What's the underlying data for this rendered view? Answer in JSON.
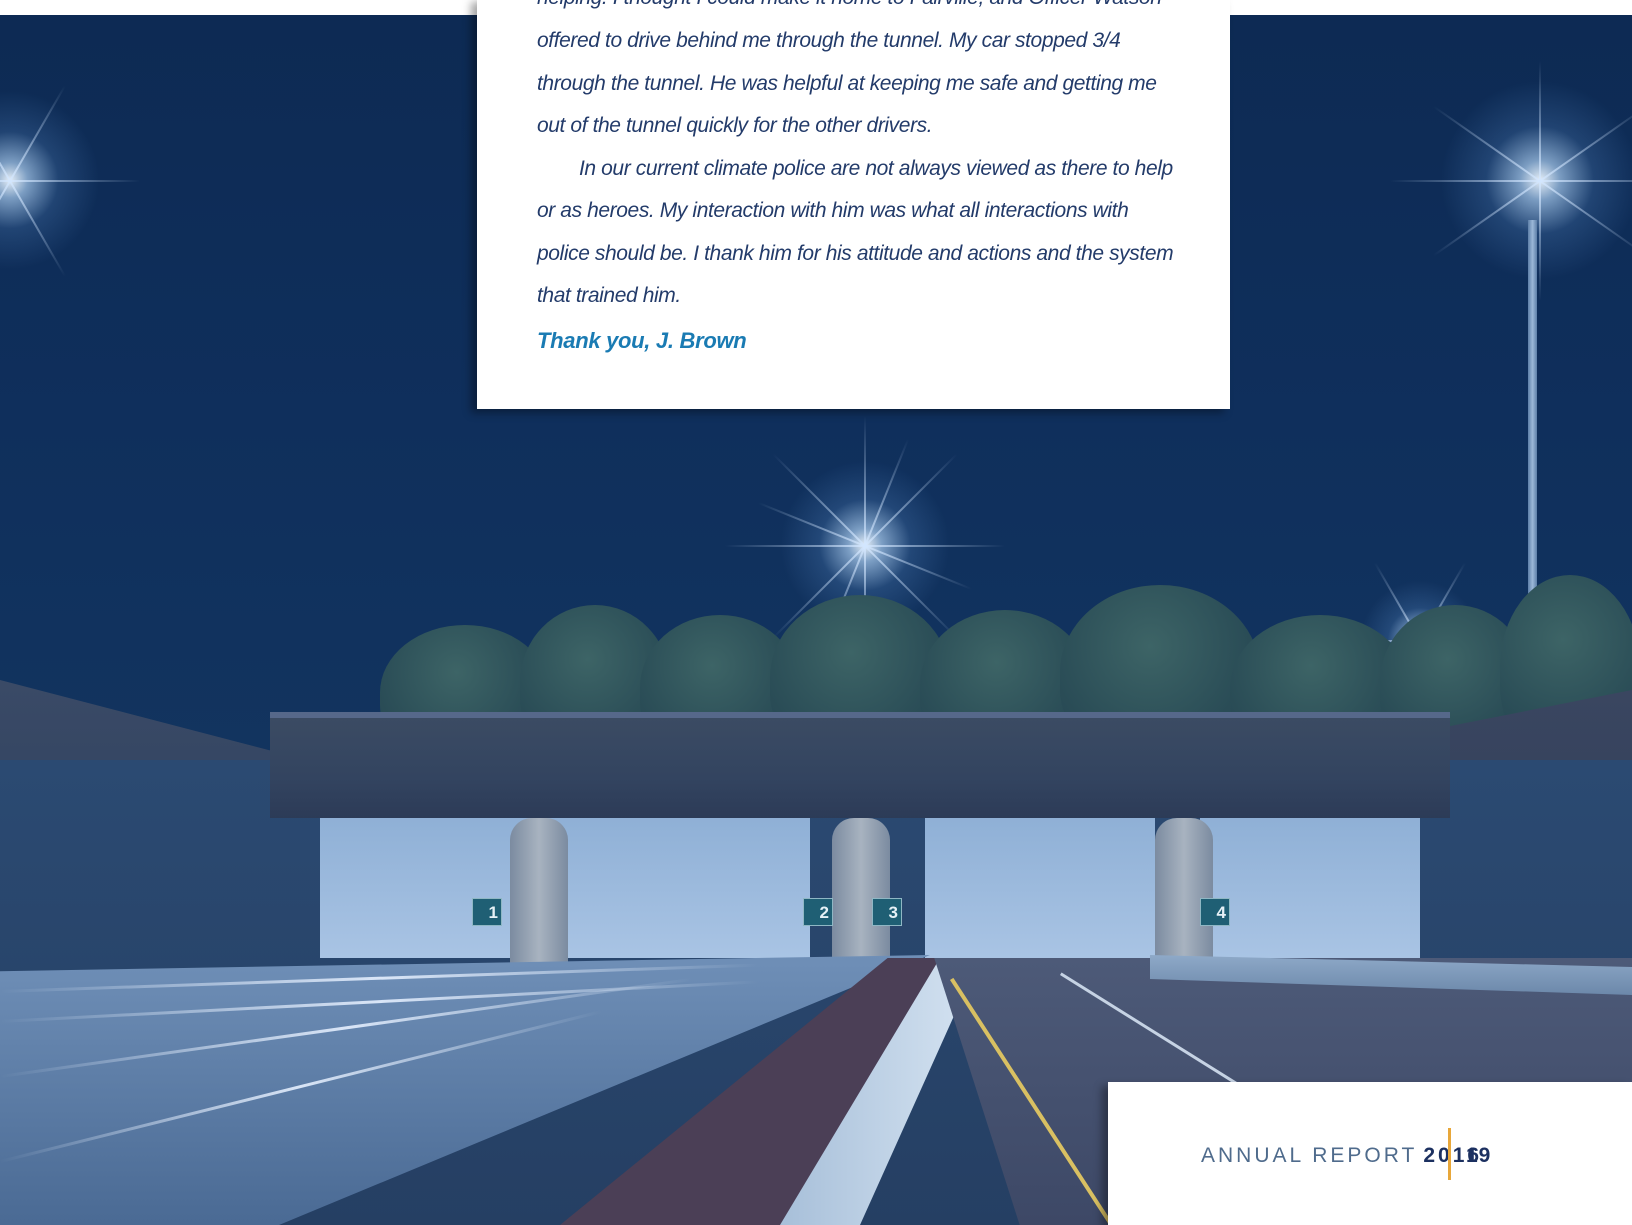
{
  "letter": {
    "partial_line": "helping.  I thought I could make it home to Fairville, and Officer Watson",
    "paragraph1_lines": [
      "offered to drive behind me through the tunnel.  My car stopped 3/4",
      "through the tunnel.  He was helpful at keeping me safe and getting me",
      "out of the tunnel quickly for the other drivers."
    ],
    "paragraph2_lines": [
      "In our current climate police are not always viewed as there to help",
      "or as heroes.  My interaction with him was what all interactions with",
      "police should be.  I thank him for his attitude and actions and the system",
      "that trained him."
    ],
    "signoff": "Thank you, J. Brown"
  },
  "footer": {
    "label": "ANNUAL REPORT",
    "year": "2016",
    "page_number": "19"
  },
  "scene": {
    "tunnel_signs": [
      "1",
      "2",
      "3",
      "4"
    ]
  },
  "colors": {
    "text_navy": "#233b6a",
    "signoff_blue": "#1a7bb3",
    "footer_accent": "#e8a73a",
    "background_navy": "#0e2a52"
  }
}
